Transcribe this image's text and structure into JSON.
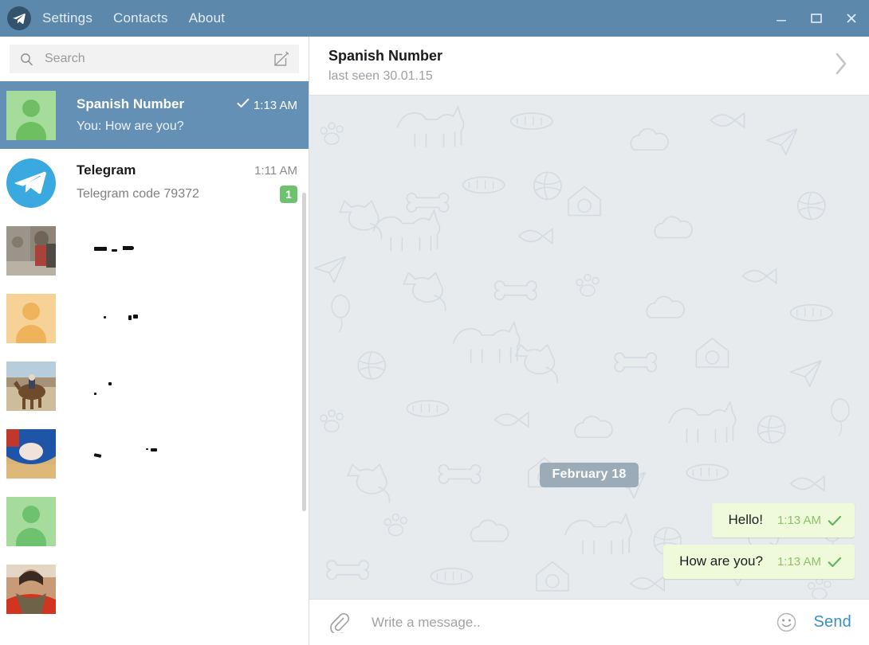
{
  "window": {
    "app_icon": "telegram-paper-plane-icon",
    "menu": [
      {
        "label": "Settings",
        "name": "menu-settings"
      },
      {
        "label": "Contacts",
        "name": "menu-contacts"
      },
      {
        "label": "About",
        "name": "menu-about"
      }
    ],
    "controls": {
      "minimize": "minimize-icon",
      "maximize": "maximize-icon",
      "close": "close-icon"
    },
    "titlebar_color": "#5c88ac"
  },
  "search": {
    "placeholder": "Search",
    "value": "",
    "icon": "search-icon",
    "compose_icon": "compose-pencil-icon"
  },
  "chatlist": {
    "items": [
      {
        "name": "Spanish Number",
        "preview": "You: How are you?",
        "time": "1:13 AM",
        "selected": true,
        "sent_check": true,
        "unread": null,
        "avatar": {
          "type": "placeholder",
          "color": "#7ac36f",
          "bg": "#a5dc9b"
        },
        "redacted": false
      },
      {
        "name": "Telegram",
        "preview": "Telegram code 79372",
        "time": "1:11 AM",
        "selected": false,
        "sent_check": false,
        "unread": "1",
        "avatar": {
          "type": "telegram-logo",
          "color": "#3aa9e0",
          "bg": "#3aa9e0"
        },
        "redacted": false
      },
      {
        "name": "",
        "preview": "",
        "time": "",
        "selected": false,
        "sent_check": false,
        "unread": null,
        "avatar": {
          "type": "photo-traveler",
          "color": "#8b8275",
          "bg": "#8b8275"
        },
        "redacted": true
      },
      {
        "name": "",
        "preview": "",
        "time": "",
        "selected": false,
        "sent_check": false,
        "unread": null,
        "avatar": {
          "type": "placeholder",
          "color": "#efb35c",
          "bg": "#f7d296"
        },
        "redacted": true
      },
      {
        "name": "",
        "preview": "",
        "time": "",
        "selected": false,
        "sent_check": false,
        "unread": null,
        "avatar": {
          "type": "photo-camel",
          "color": "#9a7b55",
          "bg": "#c8b89a"
        },
        "redacted": true
      },
      {
        "name": "",
        "preview": "",
        "time": "",
        "selected": false,
        "sent_check": false,
        "unread": null,
        "avatar": {
          "type": "photo-hamster",
          "color": "#2257a8",
          "bg": "#d9b377"
        },
        "redacted": true
      },
      {
        "name": "",
        "preview": "",
        "time": "",
        "selected": false,
        "sent_check": false,
        "unread": null,
        "avatar": {
          "type": "placeholder",
          "color": "#6ec16e",
          "bg": "#a5dc9b"
        },
        "redacted": true
      },
      {
        "name": "",
        "preview": "",
        "time": "",
        "selected": false,
        "sent_check": false,
        "unread": null,
        "avatar": {
          "type": "photo-woman-red",
          "color": "#d1341f",
          "bg": "#c99a78"
        },
        "redacted": true
      }
    ]
  },
  "chat_header": {
    "title": "Spanish Number",
    "status": "last seen 30.01.15",
    "arrow_icon": "chevron-right-icon"
  },
  "conversation": {
    "date_divider": "February 18",
    "messages": [
      {
        "text": "Hello!",
        "time": "1:13 AM",
        "outgoing": true,
        "status_icon": "single-check-icon"
      },
      {
        "text": "How are you?",
        "time": "1:13 AM",
        "outgoing": true,
        "status_icon": "single-check-icon"
      }
    ],
    "bubble_color": "#effadb",
    "background_color": "#e7ebee"
  },
  "composer": {
    "attach_icon": "paperclip-icon",
    "placeholder": "Write a message..",
    "value": "",
    "emoji_icon": "smiley-face-icon",
    "send_label": "Send",
    "send_color": "#3a8fc4"
  }
}
